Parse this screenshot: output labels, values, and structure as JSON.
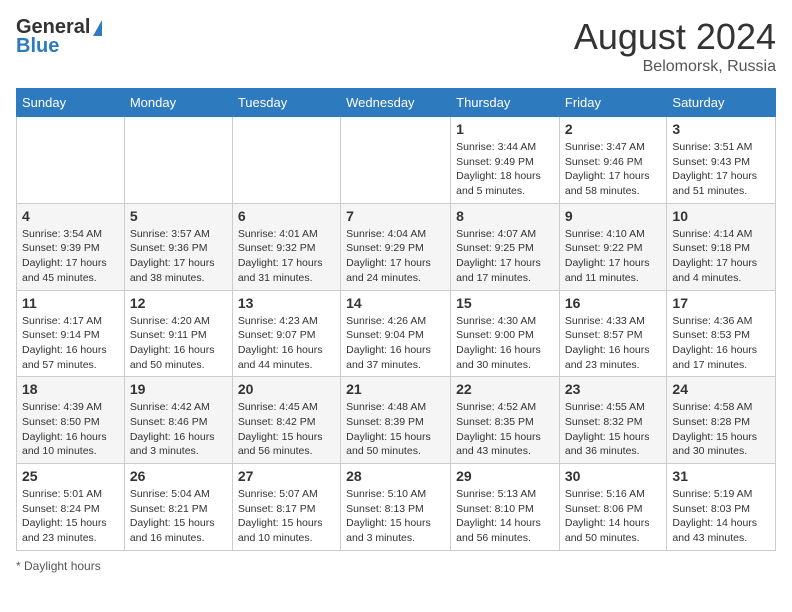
{
  "header": {
    "logo_general": "General",
    "logo_blue": "Blue",
    "month_title": "August 2024",
    "location": "Belomorsk, Russia"
  },
  "days_of_week": [
    "Sunday",
    "Monday",
    "Tuesday",
    "Wednesday",
    "Thursday",
    "Friday",
    "Saturday"
  ],
  "footer": {
    "daylight_label": "Daylight hours"
  },
  "weeks": [
    [
      {
        "day": "",
        "sunrise": "",
        "sunset": "",
        "daylight": ""
      },
      {
        "day": "",
        "sunrise": "",
        "sunset": "",
        "daylight": ""
      },
      {
        "day": "",
        "sunrise": "",
        "sunset": "",
        "daylight": ""
      },
      {
        "day": "",
        "sunrise": "",
        "sunset": "",
        "daylight": ""
      },
      {
        "day": "1",
        "sunrise": "Sunrise: 3:44 AM",
        "sunset": "Sunset: 9:49 PM",
        "daylight": "Daylight: 18 hours and 5 minutes."
      },
      {
        "day": "2",
        "sunrise": "Sunrise: 3:47 AM",
        "sunset": "Sunset: 9:46 PM",
        "daylight": "Daylight: 17 hours and 58 minutes."
      },
      {
        "day": "3",
        "sunrise": "Sunrise: 3:51 AM",
        "sunset": "Sunset: 9:43 PM",
        "daylight": "Daylight: 17 hours and 51 minutes."
      }
    ],
    [
      {
        "day": "4",
        "sunrise": "Sunrise: 3:54 AM",
        "sunset": "Sunset: 9:39 PM",
        "daylight": "Daylight: 17 hours and 45 minutes."
      },
      {
        "day": "5",
        "sunrise": "Sunrise: 3:57 AM",
        "sunset": "Sunset: 9:36 PM",
        "daylight": "Daylight: 17 hours and 38 minutes."
      },
      {
        "day": "6",
        "sunrise": "Sunrise: 4:01 AM",
        "sunset": "Sunset: 9:32 PM",
        "daylight": "Daylight: 17 hours and 31 minutes."
      },
      {
        "day": "7",
        "sunrise": "Sunrise: 4:04 AM",
        "sunset": "Sunset: 9:29 PM",
        "daylight": "Daylight: 17 hours and 24 minutes."
      },
      {
        "day": "8",
        "sunrise": "Sunrise: 4:07 AM",
        "sunset": "Sunset: 9:25 PM",
        "daylight": "Daylight: 17 hours and 17 minutes."
      },
      {
        "day": "9",
        "sunrise": "Sunrise: 4:10 AM",
        "sunset": "Sunset: 9:22 PM",
        "daylight": "Daylight: 17 hours and 11 minutes."
      },
      {
        "day": "10",
        "sunrise": "Sunrise: 4:14 AM",
        "sunset": "Sunset: 9:18 PM",
        "daylight": "Daylight: 17 hours and 4 minutes."
      }
    ],
    [
      {
        "day": "11",
        "sunrise": "Sunrise: 4:17 AM",
        "sunset": "Sunset: 9:14 PM",
        "daylight": "Daylight: 16 hours and 57 minutes."
      },
      {
        "day": "12",
        "sunrise": "Sunrise: 4:20 AM",
        "sunset": "Sunset: 9:11 PM",
        "daylight": "Daylight: 16 hours and 50 minutes."
      },
      {
        "day": "13",
        "sunrise": "Sunrise: 4:23 AM",
        "sunset": "Sunset: 9:07 PM",
        "daylight": "Daylight: 16 hours and 44 minutes."
      },
      {
        "day": "14",
        "sunrise": "Sunrise: 4:26 AM",
        "sunset": "Sunset: 9:04 PM",
        "daylight": "Daylight: 16 hours and 37 minutes."
      },
      {
        "day": "15",
        "sunrise": "Sunrise: 4:30 AM",
        "sunset": "Sunset: 9:00 PM",
        "daylight": "Daylight: 16 hours and 30 minutes."
      },
      {
        "day": "16",
        "sunrise": "Sunrise: 4:33 AM",
        "sunset": "Sunset: 8:57 PM",
        "daylight": "Daylight: 16 hours and 23 minutes."
      },
      {
        "day": "17",
        "sunrise": "Sunrise: 4:36 AM",
        "sunset": "Sunset: 8:53 PM",
        "daylight": "Daylight: 16 hours and 17 minutes."
      }
    ],
    [
      {
        "day": "18",
        "sunrise": "Sunrise: 4:39 AM",
        "sunset": "Sunset: 8:50 PM",
        "daylight": "Daylight: 16 hours and 10 minutes."
      },
      {
        "day": "19",
        "sunrise": "Sunrise: 4:42 AM",
        "sunset": "Sunset: 8:46 PM",
        "daylight": "Daylight: 16 hours and 3 minutes."
      },
      {
        "day": "20",
        "sunrise": "Sunrise: 4:45 AM",
        "sunset": "Sunset: 8:42 PM",
        "daylight": "Daylight: 15 hours and 56 minutes."
      },
      {
        "day": "21",
        "sunrise": "Sunrise: 4:48 AM",
        "sunset": "Sunset: 8:39 PM",
        "daylight": "Daylight: 15 hours and 50 minutes."
      },
      {
        "day": "22",
        "sunrise": "Sunrise: 4:52 AM",
        "sunset": "Sunset: 8:35 PM",
        "daylight": "Daylight: 15 hours and 43 minutes."
      },
      {
        "day": "23",
        "sunrise": "Sunrise: 4:55 AM",
        "sunset": "Sunset: 8:32 PM",
        "daylight": "Daylight: 15 hours and 36 minutes."
      },
      {
        "day": "24",
        "sunrise": "Sunrise: 4:58 AM",
        "sunset": "Sunset: 8:28 PM",
        "daylight": "Daylight: 15 hours and 30 minutes."
      }
    ],
    [
      {
        "day": "25",
        "sunrise": "Sunrise: 5:01 AM",
        "sunset": "Sunset: 8:24 PM",
        "daylight": "Daylight: 15 hours and 23 minutes."
      },
      {
        "day": "26",
        "sunrise": "Sunrise: 5:04 AM",
        "sunset": "Sunset: 8:21 PM",
        "daylight": "Daylight: 15 hours and 16 minutes."
      },
      {
        "day": "27",
        "sunrise": "Sunrise: 5:07 AM",
        "sunset": "Sunset: 8:17 PM",
        "daylight": "Daylight: 15 hours and 10 minutes."
      },
      {
        "day": "28",
        "sunrise": "Sunrise: 5:10 AM",
        "sunset": "Sunset: 8:13 PM",
        "daylight": "Daylight: 15 hours and 3 minutes."
      },
      {
        "day": "29",
        "sunrise": "Sunrise: 5:13 AM",
        "sunset": "Sunset: 8:10 PM",
        "daylight": "Daylight: 14 hours and 56 minutes."
      },
      {
        "day": "30",
        "sunrise": "Sunrise: 5:16 AM",
        "sunset": "Sunset: 8:06 PM",
        "daylight": "Daylight: 14 hours and 50 minutes."
      },
      {
        "day": "31",
        "sunrise": "Sunrise: 5:19 AM",
        "sunset": "Sunset: 8:03 PM",
        "daylight": "Daylight: 14 hours and 43 minutes."
      }
    ]
  ]
}
